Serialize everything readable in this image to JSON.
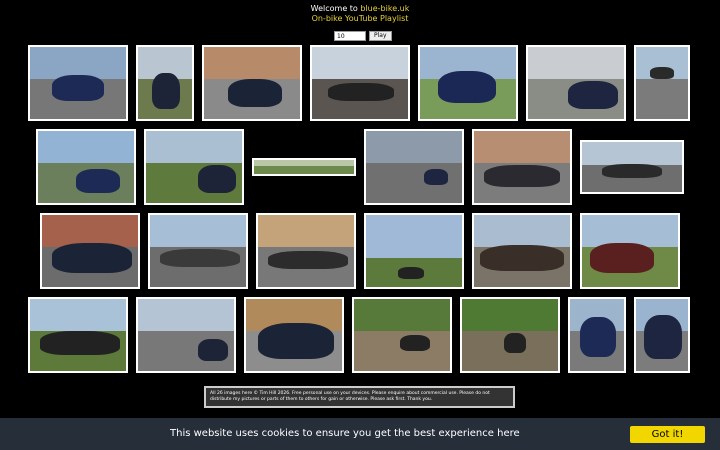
{
  "header": {
    "welcome_prefix": "Welcome to ",
    "brand": "blue-bike.uk",
    "playlist": "On-bike YouTube Playlist"
  },
  "controls": {
    "count_value": "10",
    "play_label": "Play"
  },
  "footer": {
    "text": "All 26 images here © Tim Hill 2026. Free personal use on your devices. Please enquire about commercial use. Please do not distribute my pictures or parts of them to others for gain or otherwise. Please ask first. Thank you."
  },
  "cookie": {
    "message": "This website uses cookies to ensure you get the best experience here",
    "button": "Got it!",
    "button_color": "#f1d600",
    "bar_color": "#252e39"
  },
  "colors": {
    "brand": "#e8d13a",
    "background": "#000000"
  }
}
